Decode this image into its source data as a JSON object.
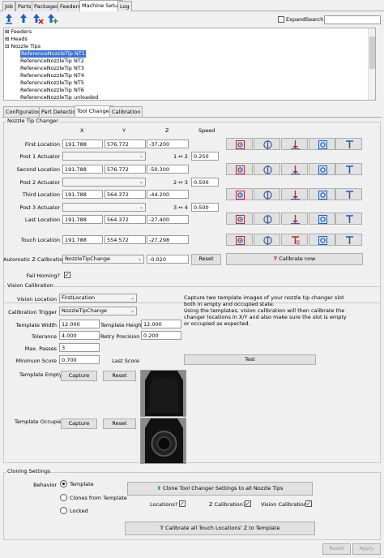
{
  "tabs": [
    "Job",
    "Parts",
    "Packages",
    "Feeders",
    "Machine Setup",
    "Log"
  ],
  "toolbar": {
    "expand_label": "Expand",
    "search_label": "Search",
    "search_value": ""
  },
  "tree": {
    "feeders": "Feeders",
    "heads": "Heads",
    "nozzle_tips": "Nozzle Tips",
    "items": [
      "ReferenceNozzleTip NT1",
      "ReferenceNozzleTip NT2",
      "ReferenceNozzleTip NT3",
      "ReferenceNozzleTip NT4",
      "ReferenceNozzleTip NT5",
      "ReferenceNozzleTip NT6",
      "ReferenceNozzleTip unloaded"
    ]
  },
  "subtabs": [
    "Configuration",
    "Part Detection",
    "Tool Changer",
    "Calibration"
  ],
  "changer": {
    "title": "Nozzle Tip Changer",
    "col_x": "X",
    "col_y": "Y",
    "col_z": "Z",
    "col_speed": "Speed",
    "rows": [
      {
        "label": "First Location",
        "x": "191.788",
        "y": "576.772",
        "z": "-37.200"
      },
      {
        "label": "Second Location",
        "x": "191.788",
        "y": "576.772",
        "z": "-50.300"
      },
      {
        "label": "Third Location",
        "x": "191.788",
        "y": "564.372",
        "z": "-44.200"
      },
      {
        "label": "Last Location",
        "x": "191.788",
        "y": "564.372",
        "z": "-27.400"
      },
      {
        "label": "Touch Location",
        "x": "191.788",
        "y": "554.572",
        "z": "-27.298"
      }
    ],
    "posts": [
      {
        "label": "Post 1 Actuator",
        "arrow": "1 ↔ 2",
        "speed": "0.250"
      },
      {
        "label": "Post 2 Actuator",
        "arrow": "2 ↔ 3",
        "speed": "0.500"
      },
      {
        "label": "Post 3 Actuator",
        "arrow": "3 ↔ 4",
        "speed": "0.500"
      }
    ],
    "auto_z_label": "Automatic Z Calibration",
    "auto_z_value": "NozzleTipChange",
    "auto_z_offset": "-0.020",
    "reset_label": "Reset",
    "calibrate_label": "Calibrate now",
    "fail_homing_label": "Fail Homing?"
  },
  "vision": {
    "title": "Vision Calibration",
    "location_label": "Vision Location",
    "location_value": "FirstLocation",
    "trigger_label": "Calibration Trigger",
    "trigger_value": "NozzleTipChange",
    "tw_label": "Template Width",
    "tw_value": "12.000",
    "th_label": "Template Height",
    "th_value": "12.000",
    "tol_label": "Tolerance",
    "tol_value": "4.000",
    "rp_label": "Retry Precision",
    "rp_value": "0.200",
    "mp_label": "Max. Passes",
    "mp_value": "3",
    "ms_label": "Minimum Score",
    "ms_value": "0.700",
    "ls_label": "Last Score",
    "ls_value": "",
    "test_label": "Test",
    "help": [
      "Capture two template images of your nozzle tip changer slot",
      "both in empty and occupied state.",
      "Using the templates, vision calibration will then calibrate the",
      "changer locations in X/Y and also make sure the slot is empty",
      "or occupied as expected."
    ],
    "empty_label": "Template Empty",
    "occupied_label": "Template Occupied",
    "capture_label": "Capture",
    "reset_label": "Reset"
  },
  "cloning": {
    "title": "Cloning Settings",
    "behavior_label": "Behavior",
    "options": [
      "Template",
      "Clones from Template",
      "Locked"
    ],
    "clone_button": "Clone Tool Changer Settings to all Nozzle Tips",
    "locations_label": "Locations?",
    "zcal_label": "Z Calibration?",
    "vcal_label": "Vision Calibration?",
    "calibrate_all": "Calibrate all Touch Locations' Z to Template"
  },
  "footer": {
    "reset_label": "Reset",
    "apply_label": "Apply"
  },
  "colors": {
    "accent": "#1c5fbf",
    "danger": "#c8202a",
    "selected": "#3b74d6"
  }
}
